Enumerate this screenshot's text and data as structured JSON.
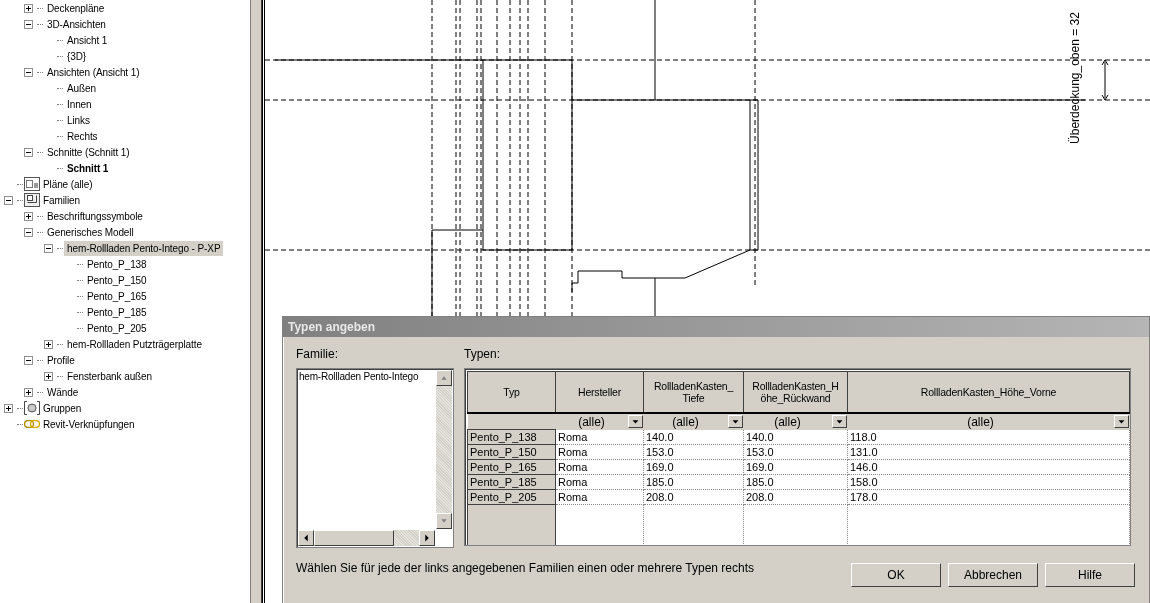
{
  "tree": {
    "continued_items": [
      {
        "label": "Deckenpläne",
        "expanded": false,
        "selected": false,
        "active": false
      },
      {
        "label": "3D-Ansichten",
        "expanded": true,
        "selected": false,
        "active": false,
        "children": [
          {
            "label": "Ansicht 1",
            "selected": false,
            "active": false
          },
          {
            "label": "{3D}",
            "selected": false,
            "active": false
          }
        ]
      },
      {
        "label": "Ansichten (Ansicht 1)",
        "expanded": true,
        "selected": false,
        "active": false,
        "children": [
          {
            "label": "Außen",
            "selected": false,
            "active": false
          },
          {
            "label": "Innen",
            "selected": false,
            "active": false
          },
          {
            "label": "Links",
            "selected": false,
            "active": false
          },
          {
            "label": "Rechts",
            "selected": false,
            "active": false
          }
        ]
      },
      {
        "label": "Schnitte (Schnitt 1)",
        "expanded": true,
        "selected": false,
        "active": false,
        "children": [
          {
            "label": "Schnitt 1",
            "selected": false,
            "active": true
          }
        ]
      }
    ],
    "items": [
      {
        "label": "Pläne (alle)",
        "kind": "sheets",
        "selected": false,
        "active": false
      },
      {
        "label": "Familien",
        "kind": "families",
        "expanded": true,
        "selected": false,
        "active": false,
        "children": [
          {
            "label": "Beschriftungssymbole",
            "expanded": false,
            "selected": false,
            "active": false
          },
          {
            "label": "Generisches Modell",
            "expanded": true,
            "selected": false,
            "active": false,
            "children": [
              {
                "label": "hem-Rollladen Pento-Intego - P-XP",
                "expanded": true,
                "selected": true,
                "active": false,
                "children": [
                  {
                    "label": "Pento_P_138",
                    "selected": false,
                    "active": false
                  },
                  {
                    "label": "Pento_P_150",
                    "selected": false,
                    "active": false
                  },
                  {
                    "label": "Pento_P_165",
                    "selected": false,
                    "active": false
                  },
                  {
                    "label": "Pento_P_185",
                    "selected": false,
                    "active": false
                  },
                  {
                    "label": "Pento_P_205",
                    "selected": false,
                    "active": false
                  }
                ]
              },
              {
                "label": "hem-Rollladen Putzträgerplatte",
                "expanded": false,
                "selected": false,
                "active": false
              }
            ]
          },
          {
            "label": "Profile",
            "expanded": true,
            "selected": false,
            "active": false,
            "children": [
              {
                "label": "Fensterbank außen",
                "expanded": false,
                "selected": false,
                "active": false
              }
            ]
          },
          {
            "label": "Wände",
            "expanded": false,
            "selected": false,
            "active": false
          }
        ]
      },
      {
        "label": "Gruppen",
        "kind": "groups",
        "expanded": false,
        "selected": false,
        "active": false
      },
      {
        "label": "Revit-Verknüpfungen",
        "kind": "links",
        "selected": false,
        "active": false
      }
    ]
  },
  "drawing": {
    "dimension_label": "Überdeckung_oben = 32"
  },
  "dialog": {
    "title": "Typen angeben",
    "family_label": "Familie:",
    "families": [
      {
        "label": "hem-Rollladen Pento-Intego",
        "selected": false
      }
    ],
    "types_label": "Typen:",
    "columns": [
      {
        "lines": [
          "Typ"
        ]
      },
      {
        "lines": [
          "Hersteller"
        ],
        "filter": "(alle)"
      },
      {
        "lines": [
          "RollladenKasten_",
          "Tiefe"
        ],
        "filter": "(alle)"
      },
      {
        "lines": [
          "RollladenKasten_H",
          "öhe_Rückwand"
        ],
        "filter": "(alle)"
      },
      {
        "lines": [
          "RollladenKasten_Höhe_Vorne"
        ],
        "filter": "(alle)"
      }
    ],
    "rows": [
      [
        "Pento_P_138",
        "Roma",
        "140.0",
        "140.0",
        "118.0"
      ],
      [
        "Pento_P_150",
        "Roma",
        "153.0",
        "153.0",
        "131.0"
      ],
      [
        "Pento_P_165",
        "Roma",
        "169.0",
        "169.0",
        "146.0"
      ],
      [
        "Pento_P_185",
        "Roma",
        "185.0",
        "185.0",
        "158.0"
      ],
      [
        "Pento_P_205",
        "Roma",
        "208.0",
        "208.0",
        "178.0"
      ]
    ],
    "hint": "Wählen Sie für jede der links angegebenen Familien einen oder mehrere Typen rechts",
    "buttons": [
      "OK",
      "Abbrechen",
      "Hilfe"
    ]
  }
}
